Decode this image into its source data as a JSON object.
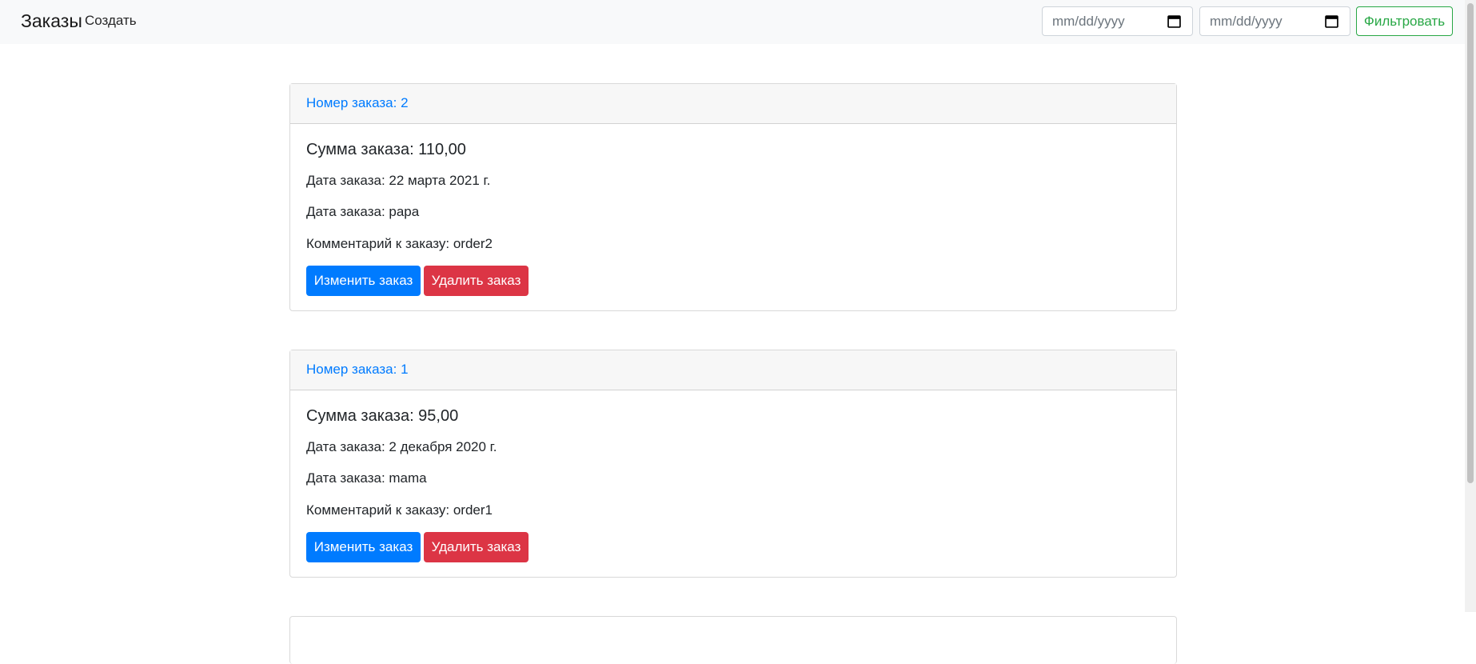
{
  "navbar": {
    "brand": "Заказы",
    "create_link": "Создать",
    "date_from_placeholder": "mm/dd/yyyy",
    "date_to_placeholder": "mm/dd/yyyy",
    "filter_button": "Фильтровать"
  },
  "orders": [
    {
      "header": "Номер заказа: 2",
      "sum": "Сумма заказа: 110,00",
      "date": "Дата заказа: 22 марта 2021 г.",
      "customer": "Дата заказа: papa",
      "comment": "Комментарий к заказу: order2",
      "edit_label": "Изменить заказ",
      "delete_label": "Удалить заказ"
    },
    {
      "header": "Номер заказа: 1",
      "sum": "Сумма заказа: 95,00",
      "date": "Дата заказа: 2 декабря 2020 г.",
      "customer": "Дата заказа: mama",
      "comment": "Комментарий к заказу: order1",
      "edit_label": "Изменить заказ",
      "delete_label": "Удалить заказ"
    }
  ],
  "colors": {
    "primary": "#007bff",
    "danger": "#dc3545",
    "success": "#28a745",
    "navbar_bg": "#f8f9fa"
  }
}
